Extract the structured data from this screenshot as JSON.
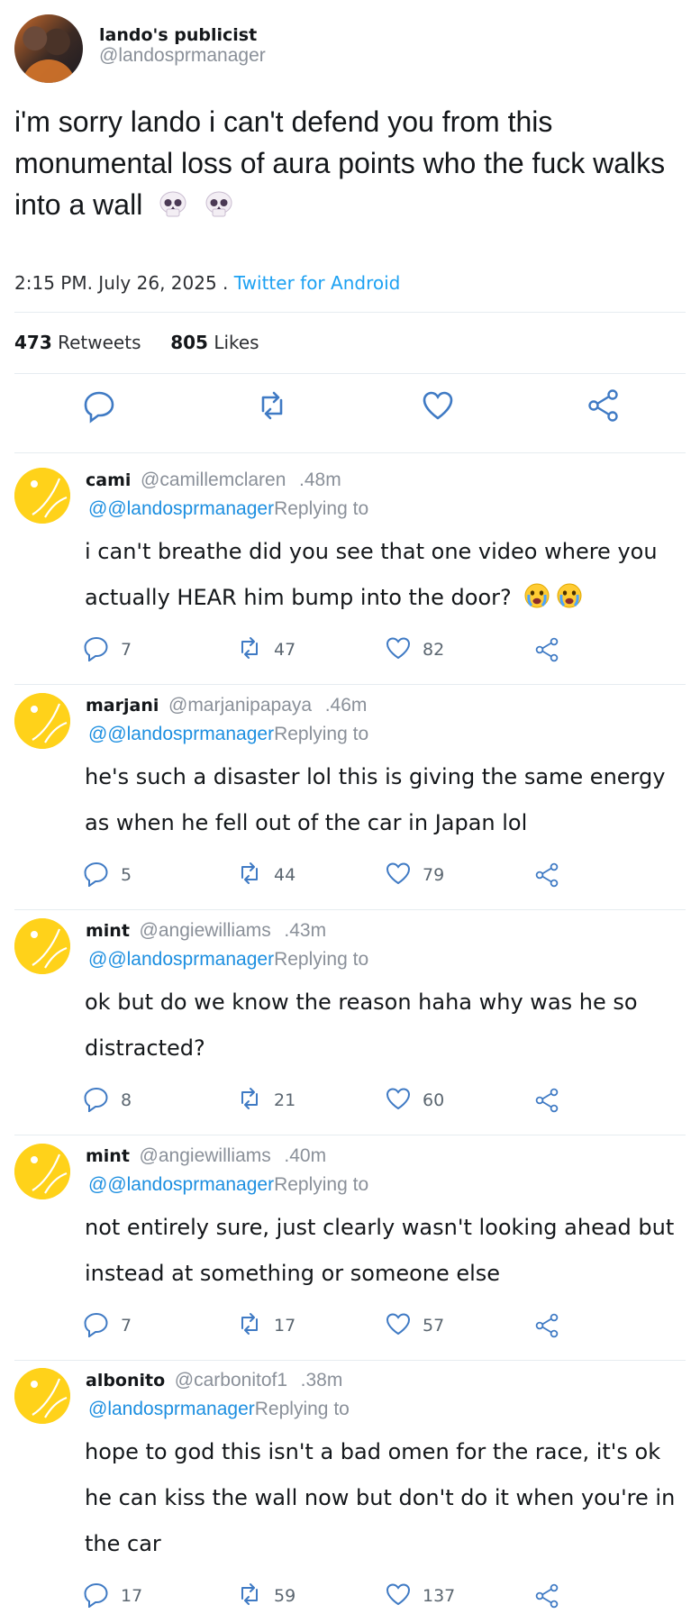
{
  "main_tweet": {
    "display_name": "lando's publicist",
    "handle": "@landosprmanager",
    "text": "i'm sorry lando i can't defend you from this monumental loss of aura points who the fuck walks into a wall",
    "emoji": "skull-emoji",
    "timestamp": "2:15 PM. July 26, 2025 .",
    "via": "Twitter for Android",
    "retweets_count": "473",
    "retweets_label": "Retweets",
    "likes_count": "805",
    "likes_label": "Likes"
  },
  "colors": {
    "link": "#1da1f2",
    "muted": "#8a9099",
    "avatar_yellow": "#ffd21a"
  },
  "replies": [
    {
      "name": "cami",
      "handle": "@camillemclaren",
      "time": ".48m",
      "reply_to_handle": "@@landosprmanager",
      "reply_to_label": "Replying to",
      "text": "i can't breathe did you see that one video where you actually HEAR him bump into the door?",
      "comments": "7",
      "retweets": "47",
      "likes": "82"
    },
    {
      "name": "marjani",
      "handle": "@marjanipapaya",
      "time": ".46m",
      "reply_to_handle": "@@landosprmanager",
      "reply_to_label": "Replying to",
      "text": "he's such a disaster lol this is giving the same energy as when he fell out of the car in Japan lol",
      "comments": "5",
      "retweets": "44",
      "likes": "79"
    },
    {
      "name": "mint",
      "handle": "@angiewilliams",
      "time": ".43m",
      "reply_to_handle": "@@landosprmanager",
      "reply_to_label": "Replying to",
      "text": "ok but do we know the reason haha why was he so distracted?",
      "comments": "8",
      "retweets": "21",
      "likes": "60"
    },
    {
      "name": "mint",
      "handle": "@angiewilliams",
      "time": ".40m",
      "reply_to_handle": "@@landosprmanager",
      "reply_to_label": "Replying to",
      "text": "not entirely sure, just clearly wasn't looking ahead but instead at something or someone else",
      "comments": "7",
      "retweets": "17",
      "likes": "57"
    },
    {
      "name": "albonito",
      "handle": "@carbonitof1",
      "time": ".38m",
      "reply_to_handle": "@landosprmanager",
      "reply_to_label": "Replying to",
      "text": "hope to god this isn't a bad omen for the race, it's ok he can kiss the wall now but don't do it when you're in the car",
      "comments": "17",
      "retweets": "59",
      "likes": "137"
    }
  ]
}
